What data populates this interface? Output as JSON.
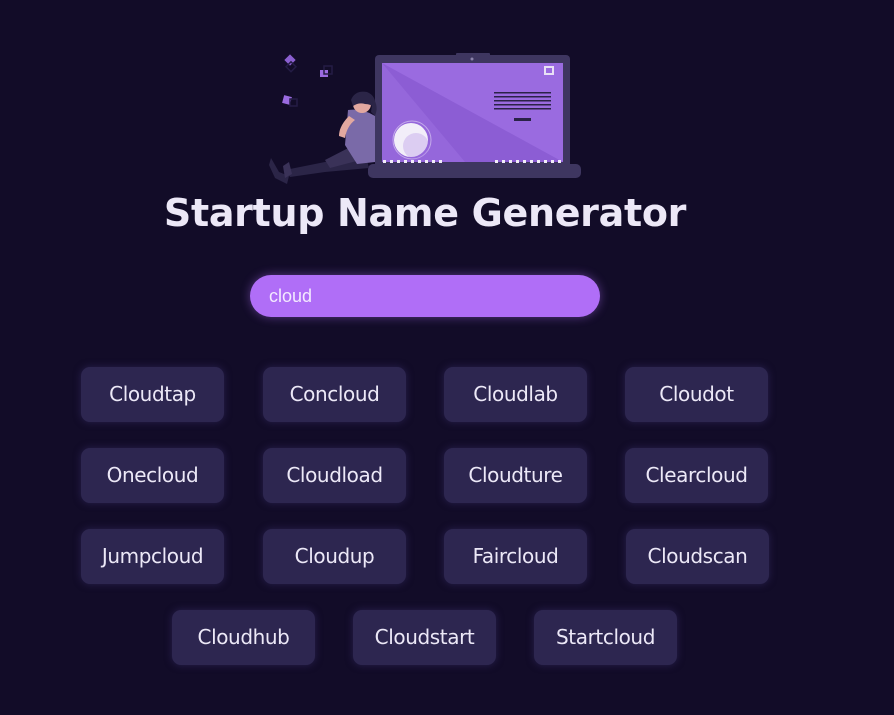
{
  "page": {
    "title": "Startup Name Generator"
  },
  "search": {
    "value": "cloud"
  },
  "names": [
    "Cloudtap",
    "Concloud",
    "Cloudlab",
    "Cloudot",
    "Onecloud",
    "Cloudload",
    "Cloudture",
    "Clearcloud",
    "Jumpcloud",
    "Cloudup",
    "Faircloud",
    "Cloudscan",
    "Cloudhub",
    "Cloudstart",
    "Startcloud"
  ],
  "colors": {
    "background": "#120c28",
    "accent": "#b06ef7",
    "card": "#2d2650",
    "text": "#ece8f7"
  },
  "hero": {
    "icon": "person-with-laptop-illustration"
  }
}
